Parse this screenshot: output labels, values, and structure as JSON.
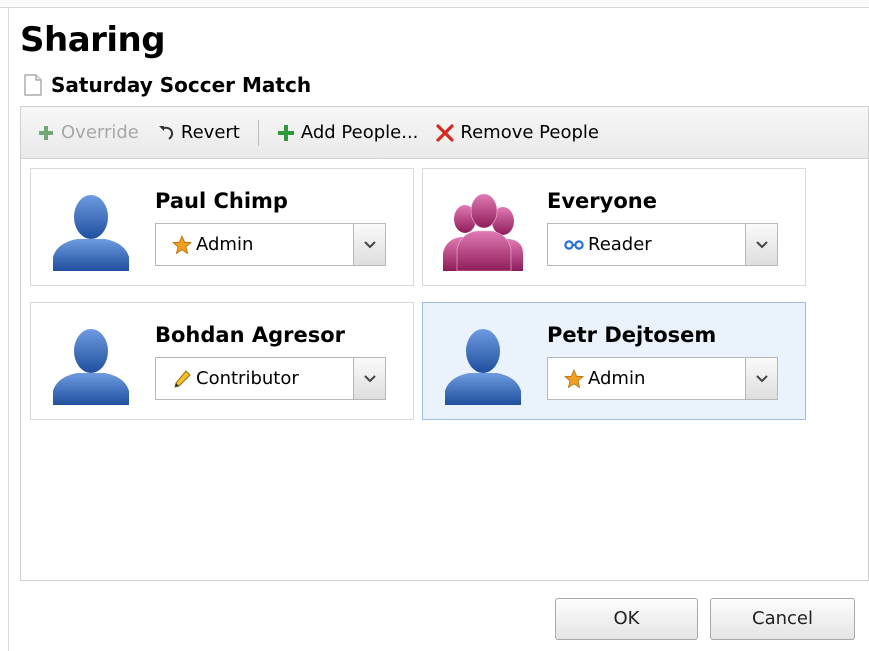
{
  "dialog": {
    "title": "Sharing"
  },
  "document": {
    "name": "Saturday Soccer Match",
    "icon": "document-icon"
  },
  "toolbar": {
    "override_label": "Override",
    "revert_label": "Revert",
    "add_people_label": "Add People...",
    "remove_people_label": "Remove People",
    "override_enabled": false
  },
  "people": [
    {
      "name": "Paul Chimp",
      "role": "Admin",
      "role_icon": "star-icon",
      "avatar": "user-icon",
      "selected": false
    },
    {
      "name": "Everyone",
      "role": "Reader",
      "role_icon": "glasses-icon",
      "avatar": "group-icon",
      "selected": false
    },
    {
      "name": "Bohdan Agresor",
      "role": "Contributor",
      "role_icon": "pencil-icon",
      "avatar": "user-icon",
      "selected": false
    },
    {
      "name": "Petr Dejtosem",
      "role": "Admin",
      "role_icon": "star-icon",
      "avatar": "user-icon",
      "selected": true
    }
  ],
  "buttons": {
    "ok_label": "OK",
    "cancel_label": "Cancel"
  },
  "colors": {
    "user_avatar": "#2f63b7",
    "group_avatar": "#b8307c",
    "add_icon": "#2f9a3a",
    "remove_icon": "#d22b1f",
    "star": "#f0a020",
    "reader_icon": "#2a6fd6",
    "selection_bg": "#eaf2fb"
  }
}
